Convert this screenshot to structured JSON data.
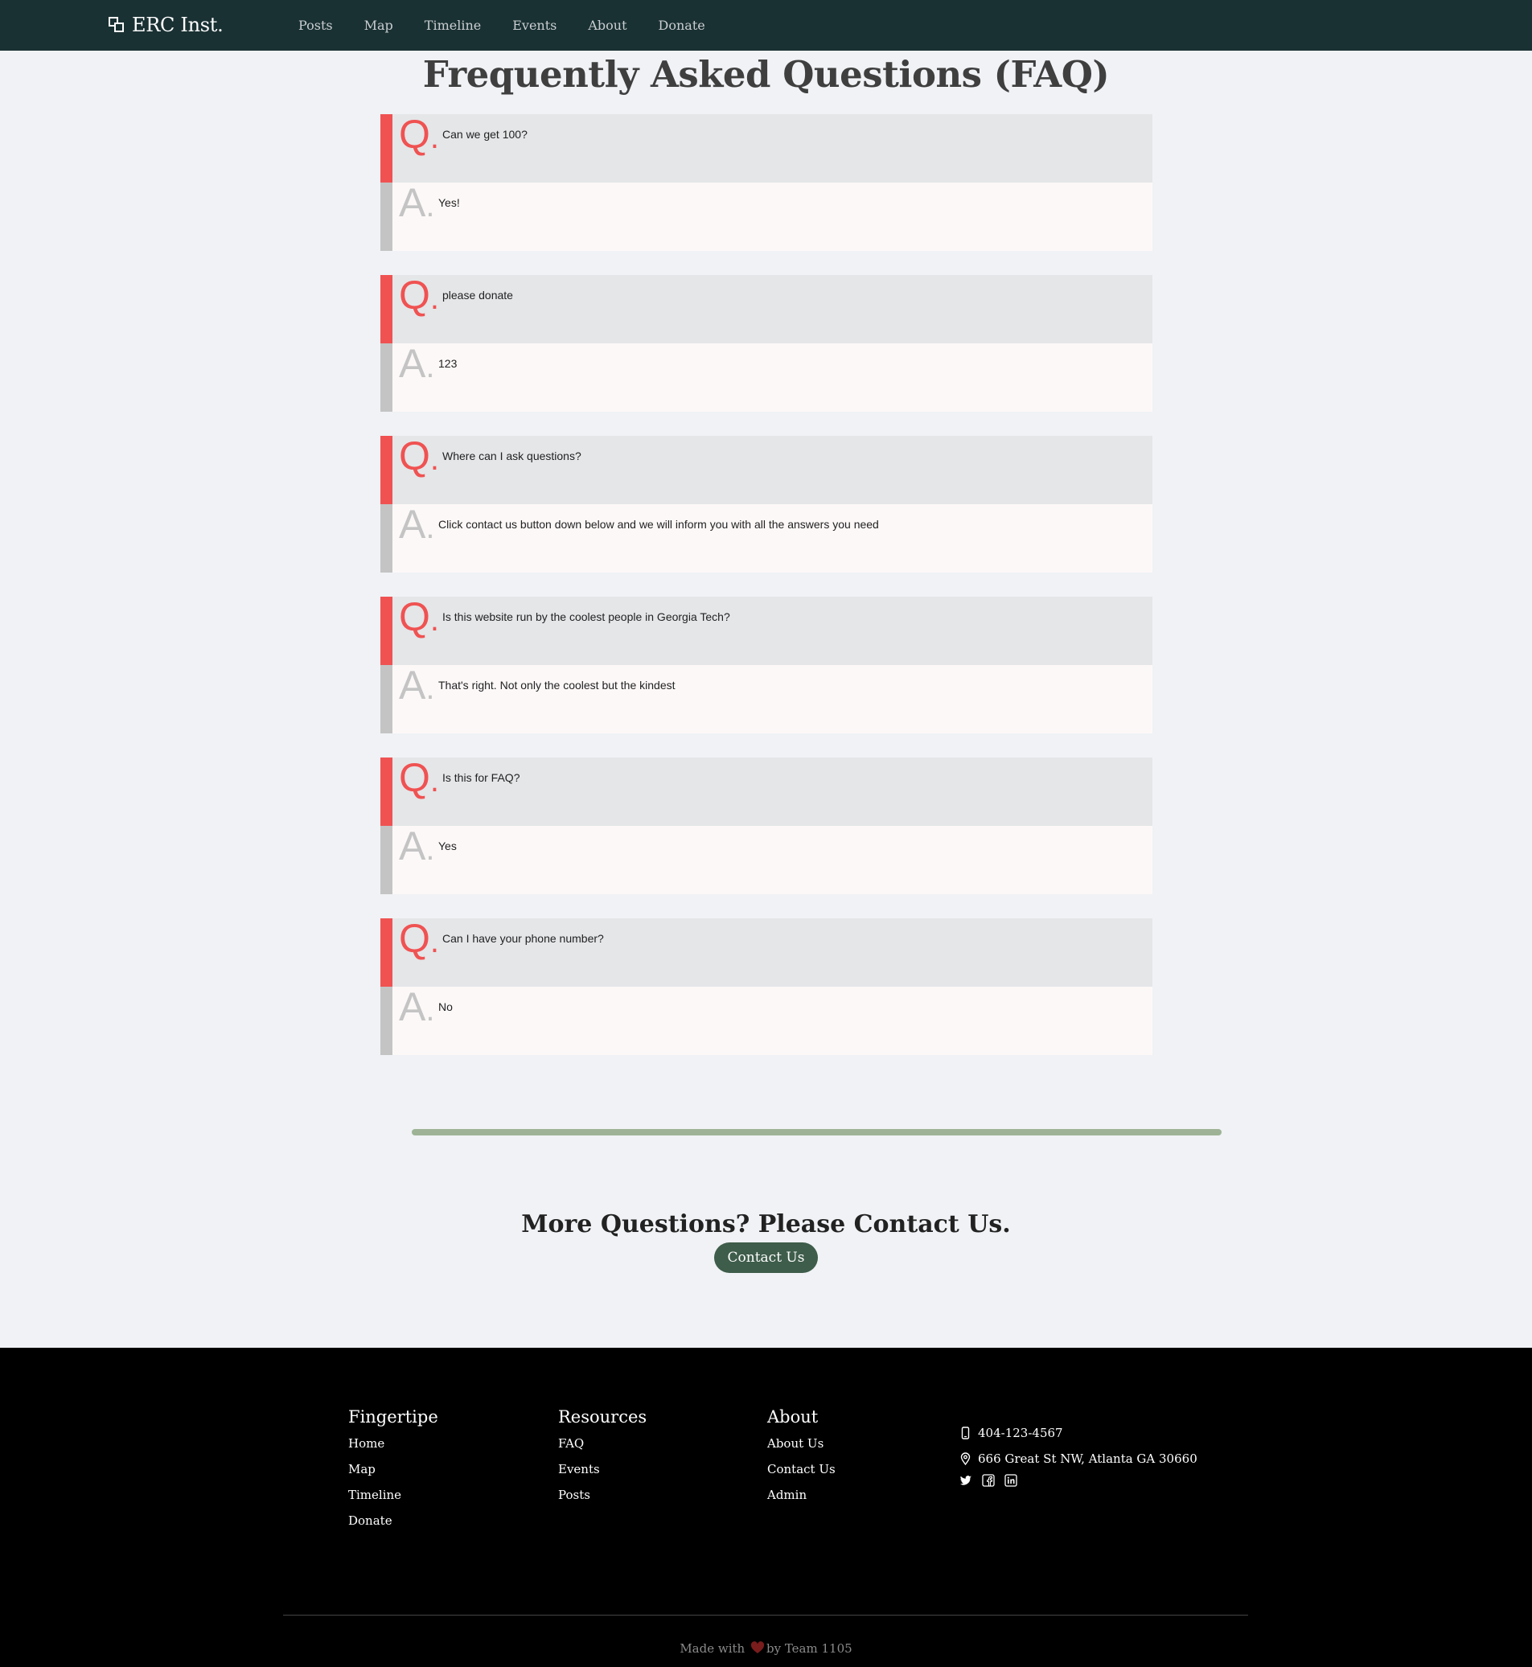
{
  "nav": {
    "brand": "ERC Inst.",
    "links": [
      "Posts",
      "Map",
      "Timeline",
      "Events",
      "About",
      "Donate"
    ]
  },
  "page_title": "Frequently Asked Questions (FAQ)",
  "faq": {
    "q_letter": "Q",
    "a_letter": "A",
    "items": [
      {
        "q": "Can we get 100?",
        "a": "Yes!"
      },
      {
        "q": "please donate",
        "a": "123"
      },
      {
        "q": "Where can I ask questions?",
        "a": "Click contact us button down below and we will inform you with all the answers you need"
      },
      {
        "q": "Is this website run by the coolest people in Georgia Tech?",
        "a": "That's right. Not only the coolest but the kindest"
      },
      {
        "q": "Is this for FAQ?",
        "a": "Yes"
      },
      {
        "q": "Can I have your phone number?",
        "a": "No"
      }
    ]
  },
  "contact": {
    "heading": "More Questions? Please Contact Us.",
    "button": "Contact Us"
  },
  "footer": {
    "columns": [
      {
        "heading": "Fingertipe",
        "links": [
          "Home",
          "Map",
          "Timeline",
          "Donate"
        ]
      },
      {
        "heading": "Resources",
        "links": [
          "FAQ",
          "Events",
          "Posts"
        ]
      },
      {
        "heading": "About",
        "links": [
          "About Us",
          "Contact Us",
          "Admin"
        ]
      }
    ],
    "phone": "404-123-4567",
    "address": "666 Great St NW, Atlanta GA 30660",
    "socials": [
      "twitter-icon",
      "facebook-icon",
      "linkedin-icon"
    ],
    "made_with_prefix": "Made with",
    "made_with_suffix": "by Team 1105"
  },
  "colors": {
    "nav_bg": "#1a3133",
    "q_accent": "#f05252",
    "a_accent": "#c4c4c4",
    "divider": "#9eb396",
    "button": "#3e5d4a",
    "heart": "#7a1c1c"
  }
}
